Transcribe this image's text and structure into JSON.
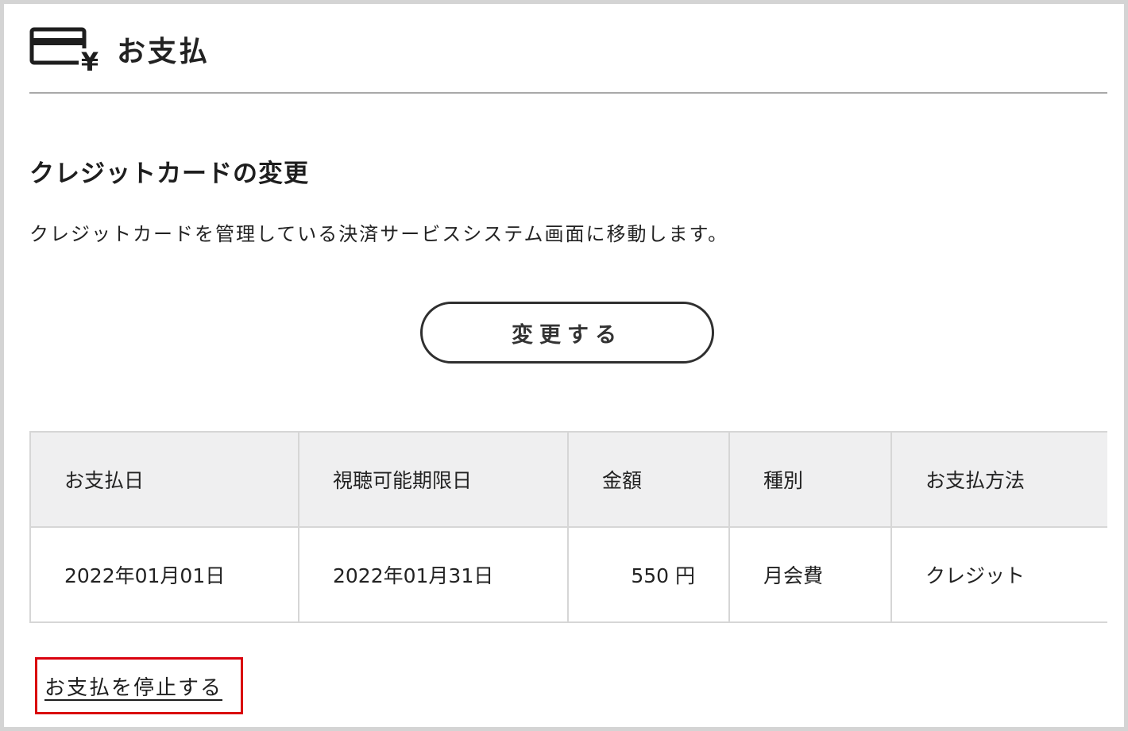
{
  "header": {
    "title": "お支払",
    "icon": "card-yen-icon",
    "icon_glyph": "¥"
  },
  "card_section": {
    "title": "クレジットカードの変更",
    "description": "クレジットカードを管理している決済サービスシステム画面に移動します。",
    "button_label": "変更する"
  },
  "payments_table": {
    "headers": [
      "お支払日",
      "視聴可能期限日",
      "金額",
      "種別",
      "お支払方法"
    ],
    "rows": [
      {
        "payment_date": "2022年01月01日",
        "viewing_deadline": "2022年01月31日",
        "amount": "550 円",
        "type": "月会費",
        "method": "クレジット"
      }
    ]
  },
  "stop_link": {
    "label": "お支払を停止する",
    "highlight_color": "#d9000d"
  },
  "colors": {
    "header_rule": "#a9a9a9",
    "table_header_bg": "#efeff0",
    "table_border": "#d6d6d6",
    "frame_border": "#d4d4d4"
  }
}
